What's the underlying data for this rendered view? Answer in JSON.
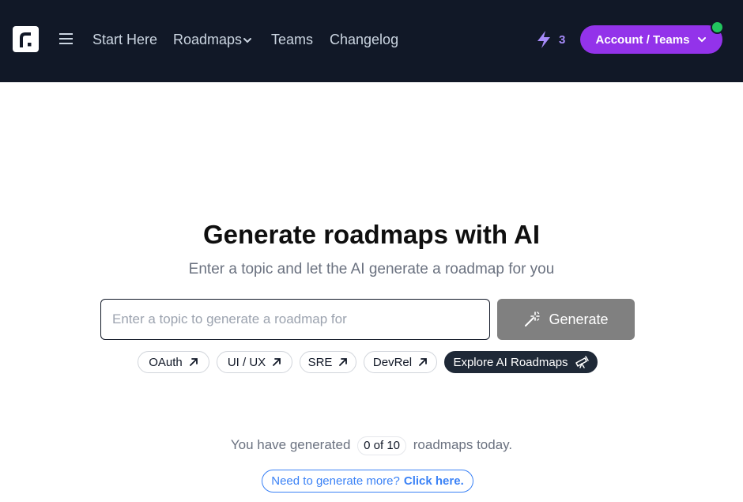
{
  "header": {
    "nav": {
      "start_here": "Start Here",
      "roadmaps": "Roadmaps",
      "teams": "Teams",
      "changelog": "Changelog"
    },
    "credits_count": "3",
    "account_label": "Account / Teams"
  },
  "main": {
    "title": "Generate roadmaps with AI",
    "subtitle": "Enter a topic and let the AI generate a roadmap for you",
    "input_value": "",
    "input_placeholder": "Enter a topic to generate a roadmap for",
    "generate_label": "Generate",
    "suggestions": [
      "OAuth",
      "UI / UX",
      "SRE",
      "DevRel"
    ],
    "explore_label": "Explore AI Roadmaps"
  },
  "usage": {
    "prefix": "You have generated",
    "badge": "0 of 10",
    "suffix": "roadmaps today.",
    "more_text": "Need to generate more?",
    "more_link": "Click here."
  },
  "colors": {
    "header_bg": "#111827",
    "accent_purple": "#9333ea",
    "online_green": "#22c55e",
    "link_blue": "#3b82f6",
    "generate_disabled": "#808080"
  },
  "icons": {
    "logo": "roadmap-logo-icon",
    "menu": "hamburger-icon",
    "credits": "lightning-bolt-icon",
    "generate": "magic-wand-icon",
    "suggestion": "arrow-up-right-icon",
    "explore": "telescope-icon"
  }
}
